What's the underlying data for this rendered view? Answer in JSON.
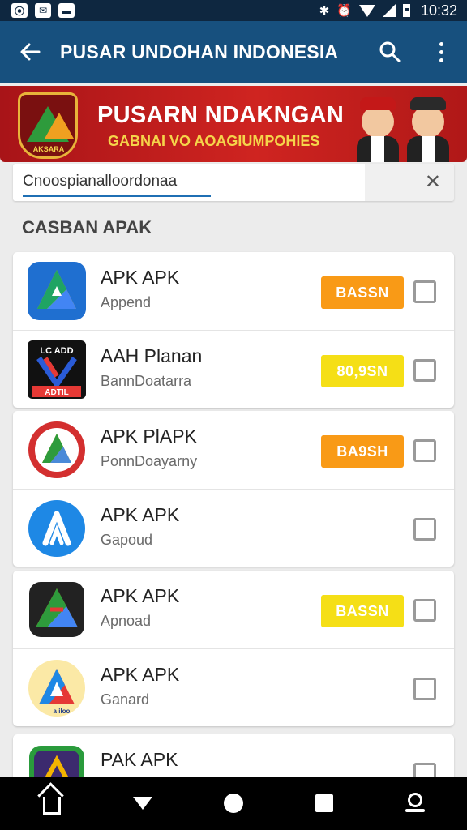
{
  "status_bar": {
    "notification_icons": [
      "camera-notification-icon",
      "mail-notification-icon",
      "image-notification-icon"
    ],
    "icons": [
      "bluetooth-icon",
      "alarm-icon",
      "wifi-icon",
      "signal-icon",
      "battery-icon"
    ],
    "time": "10:32"
  },
  "app_bar": {
    "title": "PUSAR UNDOHAN INDONESIA",
    "color": "#17507e"
  },
  "banner": {
    "title": "PUSARN NDAKNGAN",
    "subtitle": "GABNAI VO AOAGIUMPOHIES",
    "emblem_text": "AKSARA",
    "color": "#cf2420"
  },
  "search": {
    "value": "Cnoospianalloordonaa",
    "clear_icon": "close-icon"
  },
  "section": {
    "heading": "CASBAN APAK"
  },
  "colors": {
    "button_orange": "#f99a16",
    "button_yellow": "#f5df16"
  },
  "cards": [
    {
      "items": [
        {
          "icon": "green-triangle-app-icon",
          "title": "APK APK",
          "subtitle": "Append",
          "button": "BASSN",
          "button_color": "orange"
        },
        {
          "icon": "adapp-app-icon",
          "icon_text_top": "LC ADD",
          "icon_text_bottom": "ADTIL",
          "title": "AAH Planan",
          "subtitle": "BannDoatarra",
          "button": "80,9SN",
          "button_color": "yellow"
        }
      ]
    },
    {
      "items": [
        {
          "icon": "red-circle-app-icon",
          "title": "APK PlAPK",
          "subtitle": "PonnDoayarny",
          "button": "BA9SH",
          "button_color": "orange"
        },
        {
          "icon": "blue-a-app-icon",
          "title": "APK APK",
          "subtitle": "Gapoud"
        }
      ]
    },
    {
      "items": [
        {
          "icon": "drive-triangle-app-icon",
          "title": "APK APK",
          "subtitle": "Apnoad",
          "button": "BASSN",
          "button_color": "yellow"
        },
        {
          "icon": "yellow-a-app-icon",
          "icon_text": "a iloo",
          "title": "APK APK",
          "subtitle": "Ganard"
        }
      ]
    },
    {
      "items": [
        {
          "icon": "purple-app-icon",
          "title": "PAK APK"
        }
      ]
    }
  ],
  "nav_bar": {
    "icons": [
      "home-icon",
      "back-icon",
      "circle-home-icon",
      "recents-icon",
      "person-icon"
    ]
  }
}
